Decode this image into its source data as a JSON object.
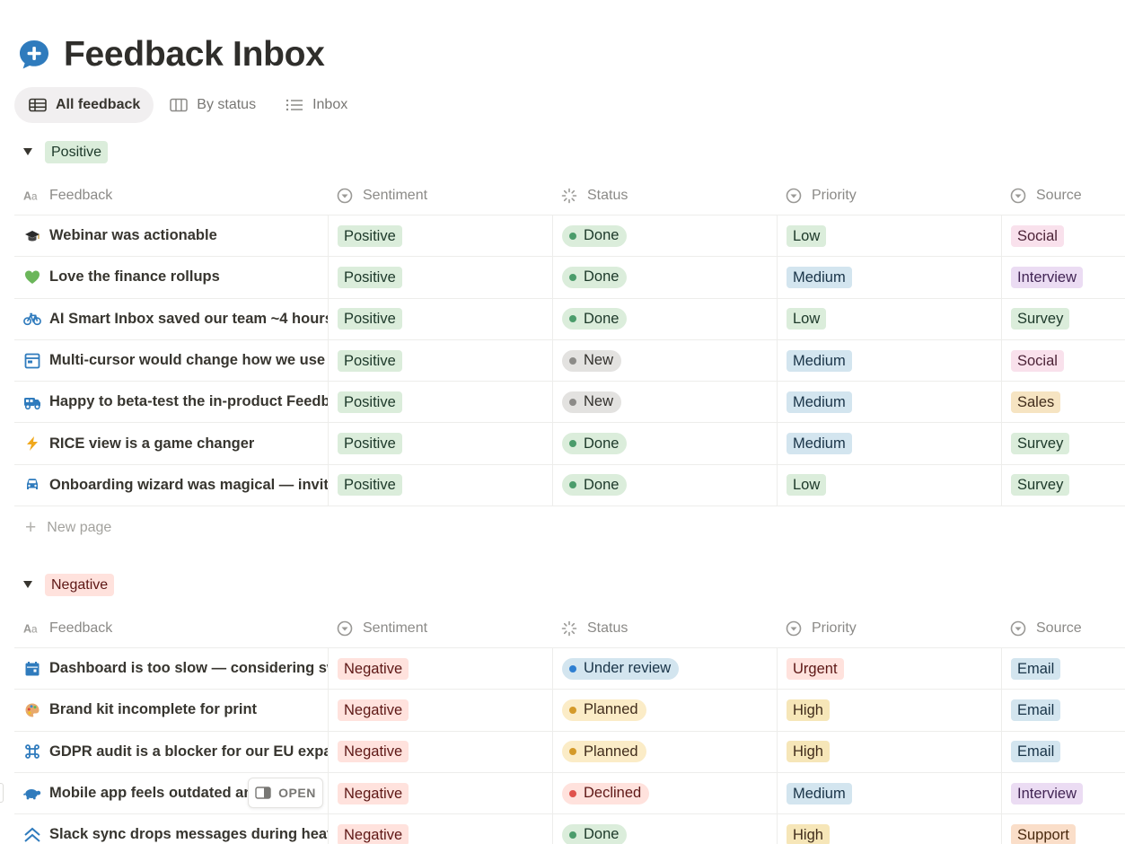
{
  "title": "Feedback Inbox",
  "tabs": [
    {
      "label": "All feedback",
      "icon": "table-icon"
    },
    {
      "label": "By status",
      "icon": "board-icon"
    },
    {
      "label": "Inbox",
      "icon": "list-icon"
    }
  ],
  "columns": {
    "feedback": "Feedback",
    "sentiment": "Sentiment",
    "status": "Status",
    "priority": "Priority",
    "source": "Source"
  },
  "new_page_label": "New page",
  "open_label": "OPEN",
  "colors": {
    "positive_bg": "#dbeddb",
    "positive_fg": "#1c3829",
    "negative_bg": "#ffe2dd",
    "negative_fg": "#5d1715",
    "accent_blue": "#2f7bbd"
  },
  "groups": [
    {
      "label": "Positive",
      "rows": [
        {
          "name": "Webinar was actionable",
          "icon": "graduation-cap-icon",
          "sentiment": "Positive",
          "status": "Done",
          "priority": "Low",
          "source": "Social"
        },
        {
          "name": "Love the finance rollups",
          "icon": "green-heart-icon",
          "sentiment": "Positive",
          "status": "Done",
          "priority": "Medium",
          "source": "Interview"
        },
        {
          "name": "AI Smart Inbox saved our team ~4 hours",
          "icon": "bicycle-icon",
          "sentiment": "Positive",
          "status": "Done",
          "priority": "Low",
          "source": "Survey"
        },
        {
          "name": "Multi-cursor would change how we use it",
          "icon": "window-icon",
          "sentiment": "Positive",
          "status": "New",
          "priority": "Medium",
          "source": "Social"
        },
        {
          "name": "Happy to beta-test the in-product Feedback",
          "icon": "truck-icon",
          "sentiment": "Positive",
          "status": "New",
          "priority": "Medium",
          "source": "Sales"
        },
        {
          "name": "RICE view is a game changer",
          "icon": "lightning-icon",
          "sentiment": "Positive",
          "status": "Done",
          "priority": "Medium",
          "source": "Survey"
        },
        {
          "name": "Onboarding wizard was magical — invite flow",
          "icon": "car-icon",
          "sentiment": "Positive",
          "status": "Done",
          "priority": "Low",
          "source": "Survey"
        }
      ]
    },
    {
      "label": "Negative",
      "rows": [
        {
          "name": "Dashboard is too slow — considering switching",
          "icon": "calendar-icon",
          "sentiment": "Negative",
          "status": "Under review",
          "priority": "Urgent",
          "source": "Email"
        },
        {
          "name": "Brand kit incomplete for print",
          "icon": "palette-icon",
          "sentiment": "Negative",
          "status": "Planned",
          "priority": "High",
          "source": "Email"
        },
        {
          "name": "GDPR audit is a blocker for our EU expansion",
          "icon": "command-icon",
          "sentiment": "Negative",
          "status": "Planned",
          "priority": "High",
          "source": "Email"
        },
        {
          "name": "Mobile app feels outdated and clunky",
          "icon": "turtle-icon",
          "sentiment": "Negative",
          "status": "Declined",
          "priority": "Medium",
          "source": "Interview"
        },
        {
          "name": "Slack sync drops messages during heavy load",
          "icon": "double-chevron-up-icon",
          "sentiment": "Negative",
          "status": "Done",
          "priority": "High",
          "source": "Support"
        }
      ]
    }
  ]
}
